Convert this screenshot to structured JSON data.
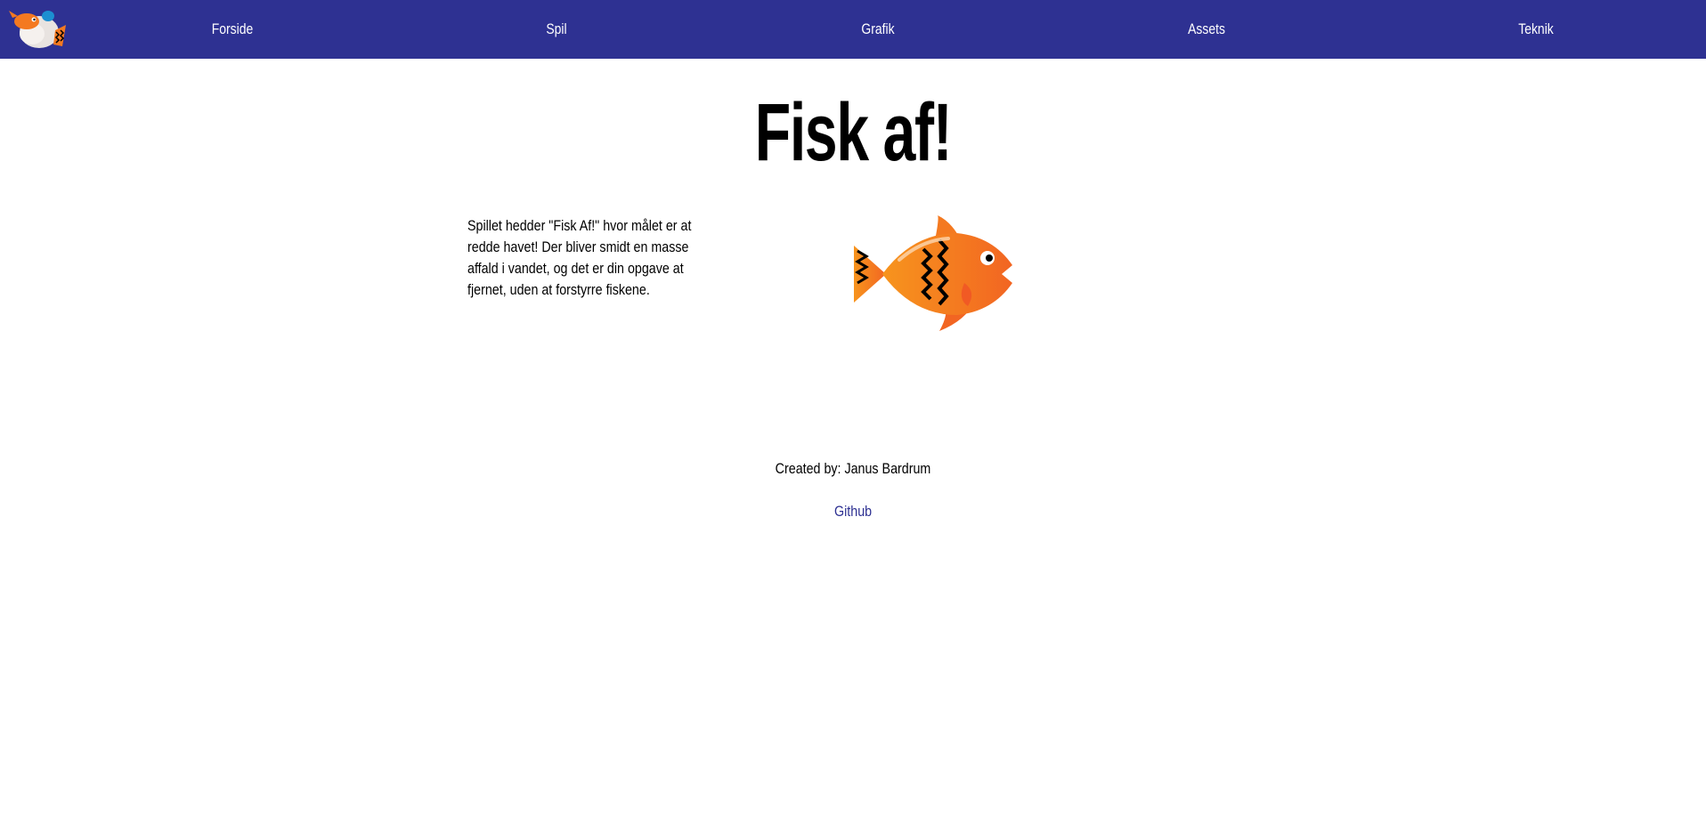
{
  "nav": {
    "logo_icon": "fish-logo-icon",
    "items": [
      {
        "label": "Forside"
      },
      {
        "label": "Spil"
      },
      {
        "label": "Grafik"
      },
      {
        "label": "Assets"
      },
      {
        "label": "Teknik"
      }
    ]
  },
  "main": {
    "title": "Fisk af!",
    "intro": "Spillet hedder \"Fisk Af!\" hvor målet er at redde havet! Der bliver smidt en masse affald i vandet, og det er din opgave at fjernet, uden at forstyrre fiskene.",
    "image_icon": "orange-fish-icon"
  },
  "footer": {
    "credit": "Created by: Janus Bardrum",
    "github_label": "Github"
  },
  "colors": {
    "nav_bg": "#2e3192",
    "nav_text": "#ffffff",
    "link": "#2e3192",
    "fish_orange": "#f47920"
  }
}
